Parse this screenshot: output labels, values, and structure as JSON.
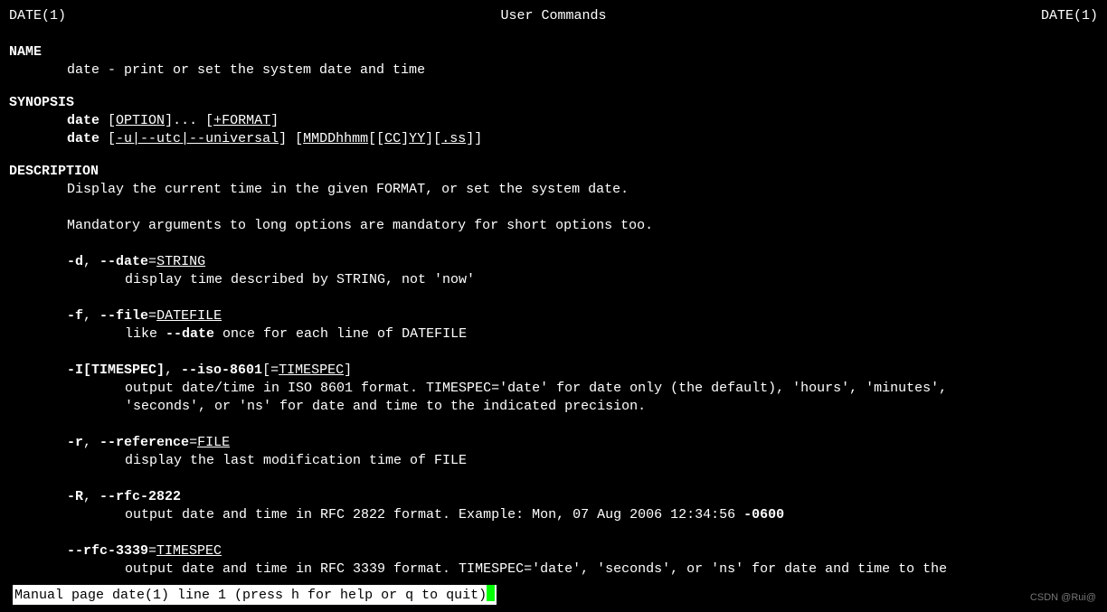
{
  "header": {
    "left": "DATE(1)",
    "center": "User Commands",
    "right": "DATE(1)"
  },
  "name": {
    "heading": "NAME",
    "text": "date - print or set the system date and time"
  },
  "synopsis": {
    "heading": "SYNOPSIS",
    "line1": {
      "cmd": "date",
      "opt": "OPTION",
      "fmt": "+FORMAT"
    },
    "line2": {
      "cmd": "date",
      "utc": "-u|--utc|--universal",
      "mmdd": "MMDDhhmm",
      "cc": "CC",
      "yy": "YY",
      "ss": ".ss"
    }
  },
  "description": {
    "heading": "DESCRIPTION",
    "intro1": "Display the current time in the given FORMAT, or set the system date.",
    "intro2": "Mandatory arguments to long options are mandatory for short options too.",
    "d": {
      "flagShort": "-d",
      "sep": ", ",
      "flagLong": "--date",
      "eq": "=",
      "arg": "STRING",
      "desc": "display time described by STRING, not 'now'"
    },
    "f": {
      "flagShort": "-f",
      "sep": ", ",
      "flagLong": "--file",
      "eq": "=",
      "arg": "DATEFILE",
      "pre": "like ",
      "mid": "--date",
      "post": " once for each line of DATEFILE"
    },
    "I": {
      "flagShort": "-I[TIMESPEC]",
      "sep": ", ",
      "flagLong": "--iso-8601",
      "lb": "[=",
      "arg": "TIMESPEC",
      "rb": "]",
      "desc1": "output  date/time in ISO 8601 format.  TIMESPEC='date' for date only (the default), 'hours', 'minutes',",
      "desc2": "'seconds', or 'ns' for date and time to the indicated precision."
    },
    "r": {
      "flagShort": "-r",
      "sep": ", ",
      "flagLong": "--reference",
      "eq": "=",
      "arg": "FILE",
      "desc": "display the last modification time of FILE"
    },
    "R": {
      "flagShort": "-R",
      "sep": ", ",
      "flagLong": "--rfc-2822",
      "pre": "output date and time in RFC 2822 format.  Example: Mon, 07 Aug 2006 12:34:56 ",
      "tz": "-0600"
    },
    "rfc3339": {
      "flagLong": "--rfc-3339",
      "eq": "=",
      "arg": "TIMESPEC",
      "desc": "output date and time in RFC 3339 format.  TIMESPEC='date', 'seconds', or 'ns' for date and time to  the"
    }
  },
  "status": "Manual page date(1) line 1 (press h for help or q to quit)",
  "watermark": "CSDN @Rui@"
}
